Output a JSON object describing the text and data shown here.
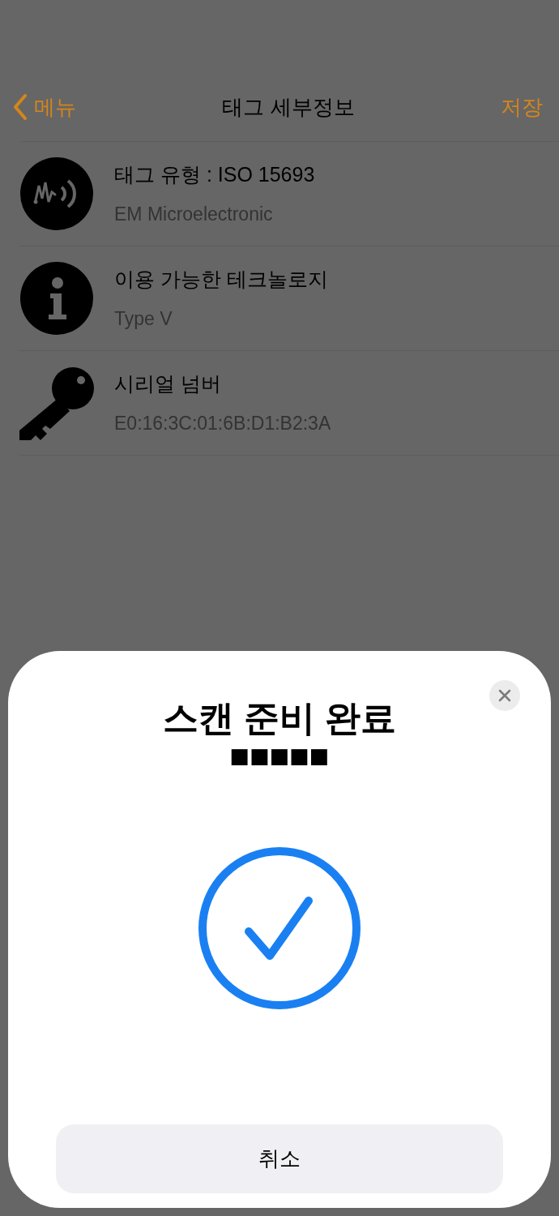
{
  "nav": {
    "back_label": "메뉴",
    "title": "태그 세부정보",
    "action": "저장"
  },
  "rows": [
    {
      "kind": "nfc",
      "title": "태그 유형 : ISO 15693",
      "subtitle": "EM Microelectronic"
    },
    {
      "kind": "info",
      "title": "이용 가능한 테크놀로지",
      "subtitle": "Type V"
    },
    {
      "kind": "key",
      "title": "시리얼 넘버",
      "subtitle": "E0:16:3C:01:6B:D1:B2:3A"
    }
  ],
  "sheet": {
    "title": "스캔 준비 완료",
    "message": "■■■■■",
    "complete": true,
    "cancel": "취소"
  }
}
